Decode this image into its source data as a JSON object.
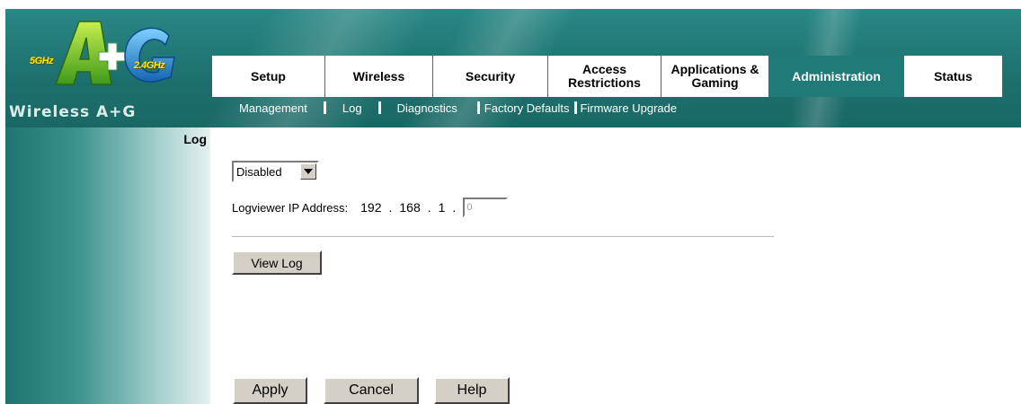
{
  "logo": {
    "band_5ghz": "5GHz",
    "band_24ghz": "2.4GHz",
    "brand": "Wireless A+G"
  },
  "tabs": [
    {
      "label": "Setup"
    },
    {
      "label": "Wireless"
    },
    {
      "label": "Security"
    },
    {
      "label": "Access Restrictions"
    },
    {
      "label": "Applications & Gaming"
    },
    {
      "label": "Administration",
      "active": true
    },
    {
      "label": "Status"
    }
  ],
  "subnav": [
    "Management",
    "Log",
    "Diagnostics",
    "Factory Defaults",
    "Firmware Upgrade"
  ],
  "section": {
    "label": "Log"
  },
  "log": {
    "select_value": "Disabled",
    "ip_label": "Logviewer IP Address:",
    "ip_octet1": "192",
    "ip_octet2": "168",
    "ip_octet3": "1",
    "ip_octet4_value": "0",
    "view_log": "View Log"
  },
  "actions": {
    "apply": "Apply",
    "cancel": "Cancel",
    "help": "Help"
  },
  "colors": {
    "brand_teal": "#1f7a78",
    "logo_green": "#6fbf2b",
    "logo_blue": "#1a7fc8",
    "band_yellow": "#ffea00"
  }
}
